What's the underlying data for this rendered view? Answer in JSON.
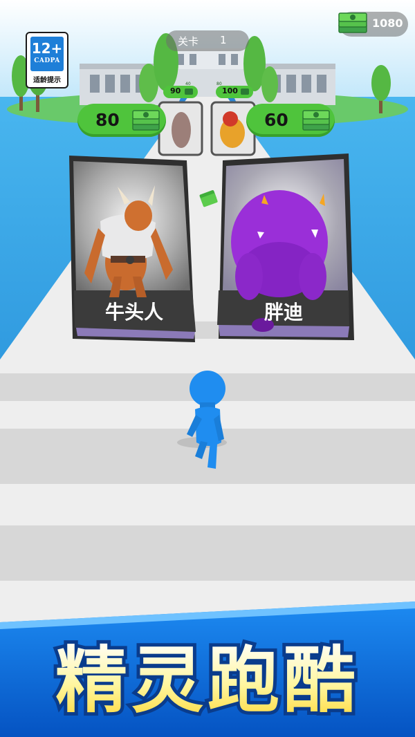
{
  "hud": {
    "age_rating": {
      "age": "12+",
      "org": "CADPA",
      "tip": "适龄提示"
    },
    "cash": {
      "value": "1080",
      "icon": "cash-stack-icon"
    },
    "level": {
      "label": "关卡",
      "number": "1"
    }
  },
  "gates_far": {
    "left": {
      "cost": "90"
    },
    "right": {
      "cost": "100"
    },
    "tiny_left": "40",
    "tiny_right": "80"
  },
  "gates_mid": {
    "left": {
      "cost": "80"
    },
    "right": {
      "cost": "60"
    }
  },
  "gates_near": {
    "left": {
      "name": "牛头人",
      "creature": "minotaur"
    },
    "right": {
      "name": "胖迪",
      "creature": "purple-monster"
    }
  },
  "banner": {
    "title": "精灵跑酷"
  },
  "colors": {
    "accent_green": "#4fc43c",
    "player_blue": "#1f8df0",
    "banner_blue": "#0a63d8",
    "title_yellow": "#fff07a"
  }
}
